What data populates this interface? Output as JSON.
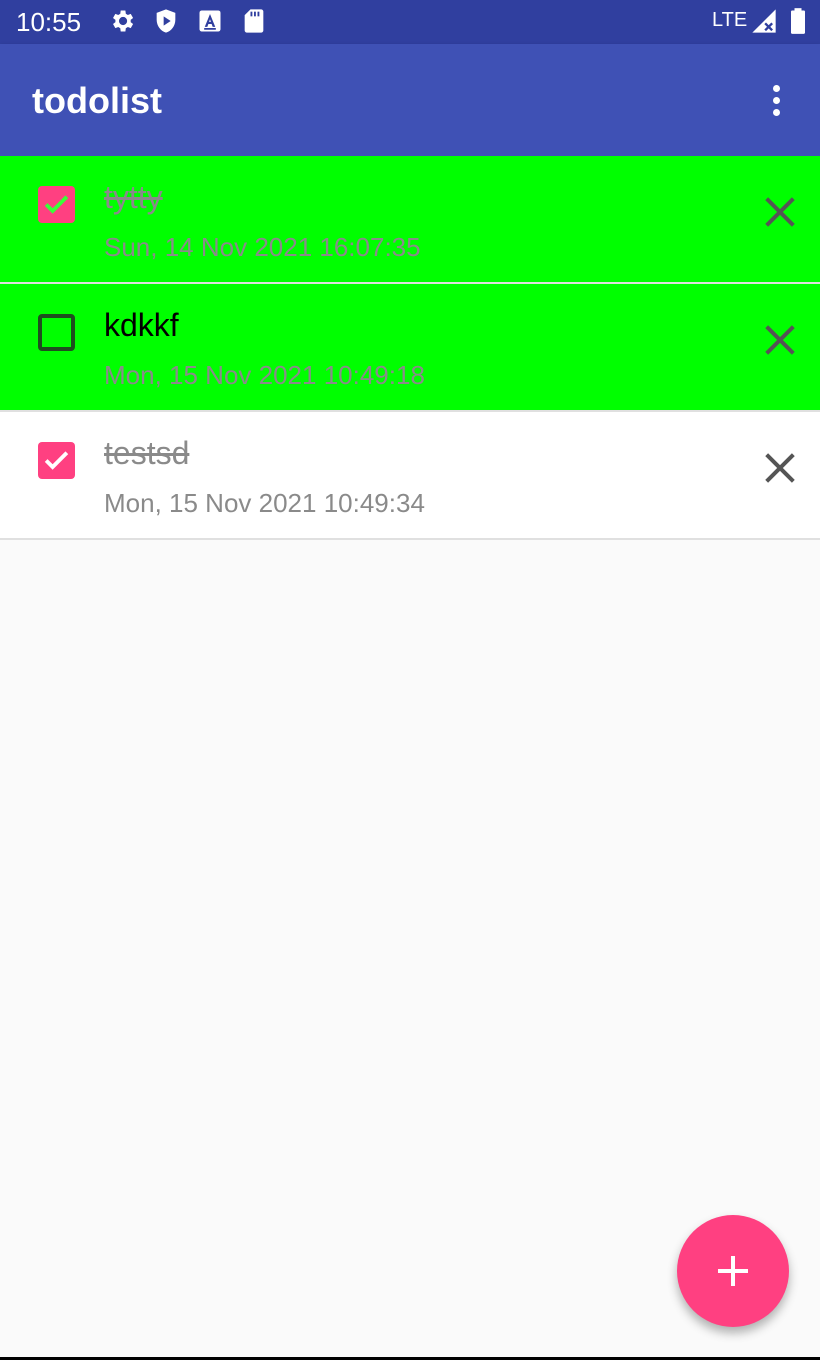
{
  "status_bar": {
    "time": "10:55",
    "network": "LTE",
    "icons": [
      "gear-icon",
      "shield-icon",
      "a-letter-icon",
      "sd-card-icon",
      "signal-icon",
      "battery-icon"
    ]
  },
  "app_bar": {
    "title": "todolist",
    "overflow_icon": "more-vert-icon"
  },
  "todos": [
    {
      "title": "tytty",
      "date": "Sun, 14 Nov 2021 16:07:35",
      "checked": true,
      "background": "#00ff00"
    },
    {
      "title": "kdkkf",
      "date": "Mon, 15 Nov 2021 10:49:18",
      "checked": false,
      "background": "#00ff00"
    },
    {
      "title": "testsd",
      "date": "Mon, 15 Nov 2021 10:49:34",
      "checked": true,
      "background": "#ffffff"
    }
  ],
  "fab": {
    "icon": "plus-icon"
  },
  "colors": {
    "status_bar": "#303f9f",
    "primary": "#3f51b5",
    "accent": "#ff4081",
    "highlight": "#00ff00",
    "muted_text": "#8a8a8a"
  }
}
